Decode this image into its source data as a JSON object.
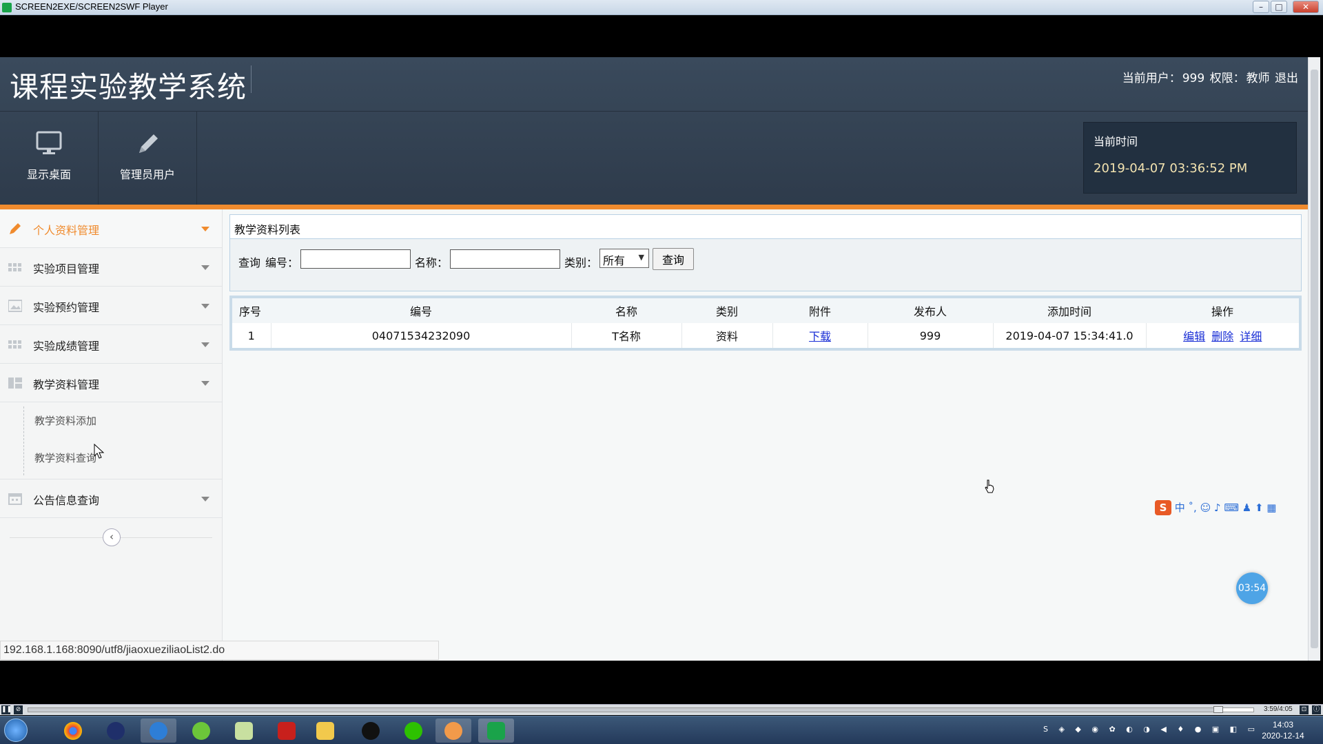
{
  "window": {
    "title": "SCREEN2EXE/SCREEN2SWF Player"
  },
  "header": {
    "app_title": "课程实验教学系统",
    "user_label": "当前用户：",
    "user_value": "999",
    "role_label": "权限：",
    "role_value": "教师",
    "logout": "退出"
  },
  "nav": [
    {
      "label": "显示桌面",
      "icon": "monitor-icon"
    },
    {
      "label": "管理员用户",
      "icon": "pencil-icon"
    }
  ],
  "timebox": {
    "label": "当前时间",
    "value": "2019-04-07 03:36:52 PM"
  },
  "sidebar": {
    "items": [
      {
        "label": "个人资料管理",
        "icon": "pencil-icon",
        "active": true
      },
      {
        "label": "实验项目管理",
        "icon": "grid-icon"
      },
      {
        "label": "实验预约管理",
        "icon": "image-icon"
      },
      {
        "label": "实验成绩管理",
        "icon": "grid-icon"
      },
      {
        "label": "教学资料管理",
        "icon": "layout-icon"
      }
    ],
    "submenu": [
      "教学资料添加",
      "教学资料查询"
    ],
    "last_item": {
      "label": "公告信息查询",
      "icon": "calendar-icon"
    },
    "collapse_glyph": "‹"
  },
  "panel": {
    "title": "教学资料列表"
  },
  "search": {
    "prefix": "查询",
    "code_label": "编号：",
    "name_label": "名称：",
    "type_label": "类别：",
    "type_selected": "所有",
    "button": "查询"
  },
  "table": {
    "headers": [
      "序号",
      "编号",
      "名称",
      "类别",
      "附件",
      "发布人",
      "添加时间",
      "操作"
    ],
    "rows": [
      {
        "index": "1",
        "code": "04071534232090",
        "name": "T名称",
        "type": "资料",
        "attachment": "下载",
        "publisher": "999",
        "added": "2019-04-07 15:34:41.0",
        "ops": [
          "编辑",
          "删除",
          "详细"
        ]
      }
    ]
  },
  "status_url": "192.168.1.168:8090/utf8/jiaoxueziliaoList2.do",
  "ime": {
    "logo": "S",
    "items": "中 ˚, ☺ ♪ ⌨ ♟ ⬆ ▦"
  },
  "timer": "03:54",
  "player": {
    "time": "3:59/4:05"
  },
  "taskbar": {
    "time": "14:03",
    "date": "2020-12-14"
  },
  "colors": {
    "header_bg": "#34424f",
    "accent_orange": "#f08b2e",
    "link_blue": "#1a2fd6"
  }
}
